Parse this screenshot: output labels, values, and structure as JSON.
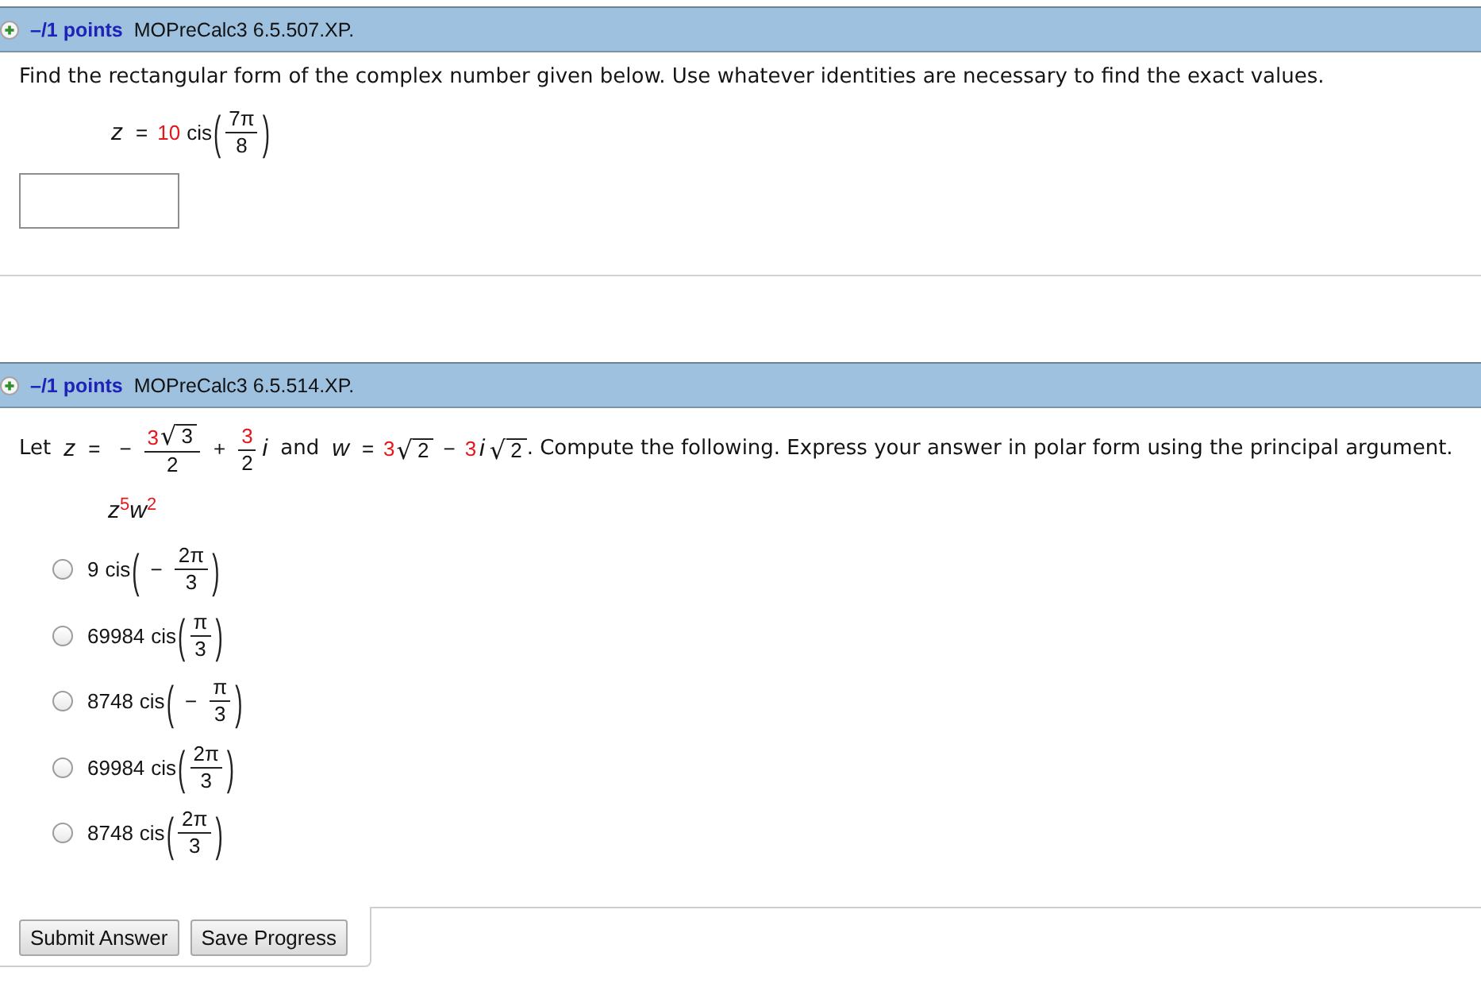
{
  "questions": [
    {
      "kind": "free_response",
      "header": {
        "points": "–/1 points",
        "code": "MOPreCalc3 6.5.507.XP."
      },
      "prompt": [
        {
          "kind": "text",
          "text": "Find the rectangular form of the complex number given below. Use whatever identities are necessary to find the exact values."
        }
      ],
      "expression": [
        {
          "kind": "var",
          "text": "z"
        },
        {
          "kind": "op",
          "text": "="
        },
        {
          "kind": "value",
          "text": "10"
        },
        {
          "kind": "func",
          "text": "cis"
        },
        {
          "kind": "paren",
          "open": "(",
          "close": ")",
          "body": [
            {
              "kind": "frac",
              "numerator": [
                {
                  "kind": "num",
                  "text": "7π"
                }
              ],
              "denominator": [
                {
                  "kind": "num",
                  "text": "8"
                }
              ]
            }
          ]
        }
      ]
    },
    {
      "kind": "multiple_choice",
      "header": {
        "points": "–/1 points",
        "code": "MOPreCalc3 6.5.514.XP."
      },
      "prompt": [
        {
          "kind": "text",
          "text": "Let"
        },
        {
          "kind": "var",
          "text": "z"
        },
        {
          "kind": "op",
          "text": "="
        },
        {
          "kind": "op",
          "text": "−"
        },
        {
          "kind": "frac",
          "numerator": [
            {
              "kind": "value",
              "text": "3"
            },
            {
              "kind": "sqrt",
              "sign": "√",
              "radicand": [
                {
                  "kind": "num",
                  "text": "3"
                }
              ]
            }
          ],
          "denominator": [
            {
              "kind": "num",
              "text": "2"
            }
          ]
        },
        {
          "kind": "op",
          "text": "+"
        },
        {
          "kind": "frac",
          "numerator": [
            {
              "kind": "value",
              "text": "3"
            }
          ],
          "denominator": [
            {
              "kind": "num",
              "text": "2"
            }
          ]
        },
        {
          "kind": "var",
          "text": "i"
        },
        {
          "kind": "text",
          "text": "and"
        },
        {
          "kind": "var",
          "text": "w"
        },
        {
          "kind": "op",
          "text": "="
        },
        {
          "kind": "value",
          "text": "3"
        },
        {
          "kind": "sqrt",
          "sign": "√",
          "radicand": [
            {
              "kind": "num",
              "text": "2"
            }
          ]
        },
        {
          "kind": "op",
          "text": "−"
        },
        {
          "kind": "value",
          "text": "3"
        },
        {
          "kind": "var",
          "text": "i"
        },
        {
          "kind": "sqrt",
          "sign": "√",
          "radicand": [
            {
              "kind": "num",
              "text": "2"
            }
          ]
        },
        {
          "kind": "text",
          "text": ". Compute the following. Express your answer in polar form using the principal argument."
        }
      ],
      "expression": [
        {
          "kind": "var",
          "text": "z"
        },
        {
          "kind": "sup",
          "body": [
            {
              "kind": "value",
              "text": "5"
            }
          ]
        },
        {
          "kind": "var",
          "text": "w"
        },
        {
          "kind": "sup",
          "body": [
            {
              "kind": "value",
              "text": "2"
            }
          ]
        }
      ],
      "options": [
        {
          "selected": false,
          "label": [
            {
              "kind": "num",
              "text": "9"
            },
            {
              "kind": "func",
              "text": "cis"
            },
            {
              "kind": "paren",
              "open": "(",
              "close": ")",
              "body": [
                {
                  "kind": "op",
                  "text": "−"
                },
                {
                  "kind": "frac",
                  "numerator": [
                    {
                      "kind": "num",
                      "text": "2π"
                    }
                  ],
                  "denominator": [
                    {
                      "kind": "num",
                      "text": "3"
                    }
                  ]
                }
              ]
            }
          ]
        },
        {
          "selected": false,
          "label": [
            {
              "kind": "num",
              "text": "69984"
            },
            {
              "kind": "func",
              "text": "cis"
            },
            {
              "kind": "paren",
              "open": "(",
              "close": ")",
              "body": [
                {
                  "kind": "frac",
                  "numerator": [
                    {
                      "kind": "num",
                      "text": "π"
                    }
                  ],
                  "denominator": [
                    {
                      "kind": "num",
                      "text": "3"
                    }
                  ]
                }
              ]
            }
          ]
        },
        {
          "selected": false,
          "label": [
            {
              "kind": "num",
              "text": "8748"
            },
            {
              "kind": "func",
              "text": "cis"
            },
            {
              "kind": "paren",
              "open": "(",
              "close": ")",
              "body": [
                {
                  "kind": "op",
                  "text": "−"
                },
                {
                  "kind": "frac",
                  "numerator": [
                    {
                      "kind": "num",
                      "text": "π"
                    }
                  ],
                  "denominator": [
                    {
                      "kind": "num",
                      "text": "3"
                    }
                  ]
                }
              ]
            }
          ]
        },
        {
          "selected": false,
          "label": [
            {
              "kind": "num",
              "text": "69984"
            },
            {
              "kind": "func",
              "text": "cis"
            },
            {
              "kind": "paren",
              "open": "(",
              "close": ")",
              "body": [
                {
                  "kind": "frac",
                  "numerator": [
                    {
                      "kind": "num",
                      "text": "2π"
                    }
                  ],
                  "denominator": [
                    {
                      "kind": "num",
                      "text": "3"
                    }
                  ]
                }
              ]
            }
          ]
        },
        {
          "selected": false,
          "label": [
            {
              "kind": "num",
              "text": "8748"
            },
            {
              "kind": "func",
              "text": "cis"
            },
            {
              "kind": "paren",
              "open": "(",
              "close": ")",
              "body": [
                {
                  "kind": "frac",
                  "numerator": [
                    {
                      "kind": "num",
                      "text": "2π"
                    }
                  ],
                  "denominator": [
                    {
                      "kind": "num",
                      "text": "3"
                    }
                  ]
                }
              ]
            }
          ]
        }
      ]
    }
  ],
  "buttons": [
    "Submit Answer",
    "Save Progress"
  ]
}
